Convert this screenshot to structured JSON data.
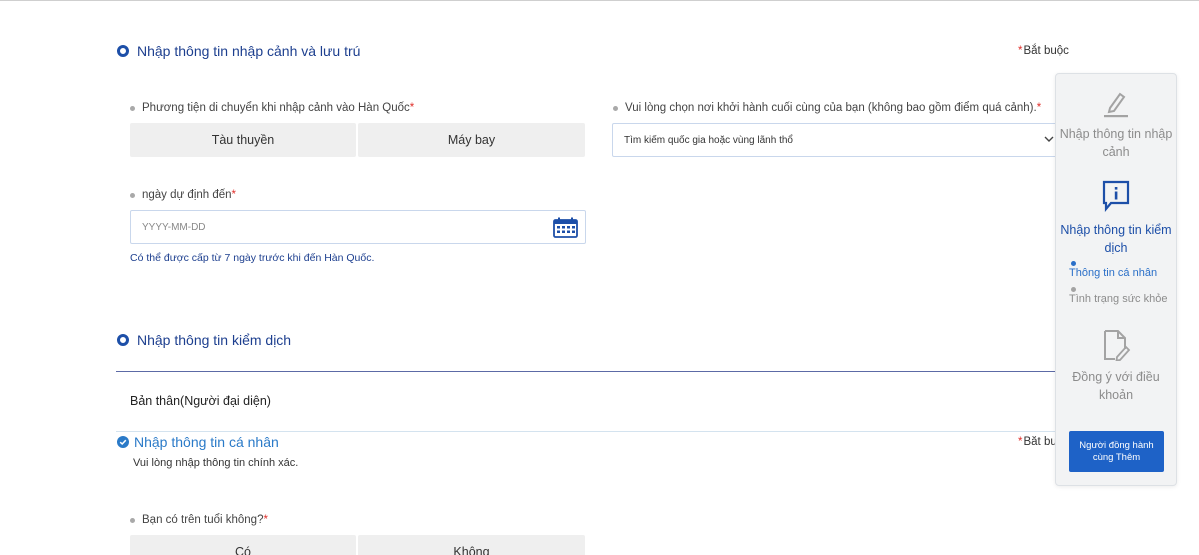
{
  "entry_section": {
    "title": "Nhập thông tin nhập cảnh và lưu trú",
    "required_star": "*",
    "required_label": "Bắt buộc",
    "transport": {
      "label": "Phương tiện di chuyển khi nhập cảnh vào Hàn Quốc",
      "star": "*",
      "options": [
        "Tàu thuyền",
        "Máy bay"
      ]
    },
    "departure": {
      "label": "Vui lòng chọn nơi khởi hành cuối cùng của bạn (không bao gồm điểm quá cảnh).",
      "star": "*",
      "placeholder": "Tìm kiếm quốc gia hoặc vùng lãnh thổ"
    },
    "arrival_date": {
      "label": "ngày dự định đến",
      "star": "*",
      "placeholder": "YYYY-MM-DD",
      "hint": "Có thể được cấp từ 7 ngày trước khi đến Hàn Quốc."
    }
  },
  "quarantine_section": {
    "title": "Nhập thông tin kiểm dịch",
    "person": "Bản thân(Người đại diện)",
    "personal": {
      "title": "Nhập thông tin cá nhân",
      "note": "Vui lòng nhập thông tin chính xác.",
      "required_star": "*",
      "required_label": "Bắt buộc"
    },
    "age_question": {
      "label": "Bạn có trên tuổi không?",
      "star": "*",
      "options": [
        "Có",
        "Không"
      ]
    }
  },
  "side_panel": {
    "steps": [
      {
        "label": "Nhập thông tin nhập cảnh",
        "icon": "pencil-icon",
        "active": false
      },
      {
        "label": "Nhập thông tin kiểm dịch",
        "icon": "info-chat-icon",
        "active": true
      },
      {
        "label": "Đồng ý với điều khoản",
        "icon": "document-edit-icon",
        "active": false
      }
    ],
    "substeps": [
      {
        "label": "Thông tin cá nhân",
        "active": true
      },
      {
        "label": "Tình trạng sức khỏe",
        "active": false
      }
    ],
    "companion_button": "Người đồng hành cùng Thêm"
  },
  "colors": {
    "primary": "#1d4fa8",
    "accent": "#2a7ac8",
    "button": "#1e62c7",
    "required": "#e0302b"
  }
}
